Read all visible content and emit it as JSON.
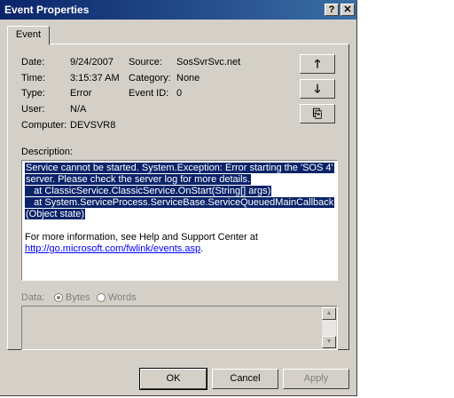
{
  "window": {
    "title": "Event Properties",
    "help_btn": "?",
    "close_btn": "✕"
  },
  "tab": {
    "label": "Event"
  },
  "fields": {
    "date_label": "Date:",
    "date_value": "9/24/2007",
    "source_label": "Source:",
    "source_value": "SosSvrSvc.net",
    "time_label": "Time:",
    "time_value": "3:15:37 AM",
    "category_label": "Category:",
    "category_value": "None",
    "type_label": "Type:",
    "type_value": "Error",
    "eventid_label": "Event ID:",
    "eventid_value": "0",
    "user_label": "User:",
    "user_value": "N/A",
    "computer_label": "Computer:",
    "computer_value": "DEVSVR8"
  },
  "side_buttons": {
    "up": "🡑",
    "down": "🡓",
    "copy": "⎘"
  },
  "description": {
    "label": "Description:",
    "lines": [
      "Service cannot be started. System.Exception: Error starting the 'SOS 4'",
      "server. Please check the server log for more details.",
      "   at ClassicService.ClassicService.OnStart(String[] args)",
      "   at System.ServiceProcess.ServiceBase.ServiceQueuedMainCallback",
      "(Object state)"
    ],
    "more_info": "For more information, see Help and Support Center at",
    "link": "http://go.microsoft.com/fwlink/events.asp",
    "link_suffix": "."
  },
  "data": {
    "label": "Data:",
    "bytes": "Bytes",
    "words": "Words",
    "selected": "Bytes"
  },
  "buttons": {
    "ok": "OK",
    "cancel": "Cancel",
    "apply": "Apply"
  }
}
